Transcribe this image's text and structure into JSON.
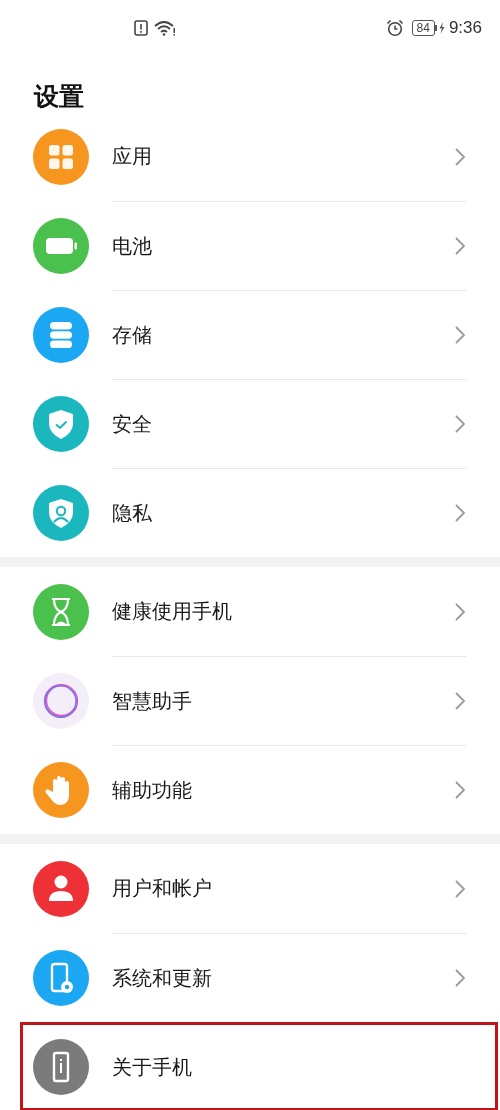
{
  "status_bar": {
    "battery": "84",
    "time": "9:36"
  },
  "title": "设置",
  "groups": [
    {
      "items": [
        {
          "label": "应用",
          "kind": "grid",
          "color": "#f7961e",
          "chevron": true,
          "highlighted": false
        },
        {
          "label": "电池",
          "kind": "battery",
          "color": "#4ac14c",
          "chevron": true,
          "highlighted": false
        },
        {
          "label": "存储",
          "kind": "storage",
          "color": "#1ba7f1",
          "chevron": true,
          "highlighted": false
        },
        {
          "label": "安全",
          "kind": "shield-check",
          "color": "#1bb7bf",
          "chevron": true,
          "highlighted": false
        },
        {
          "label": "隐私",
          "kind": "shield-user",
          "color": "#1bb7bf",
          "chevron": true,
          "highlighted": false
        }
      ]
    },
    {
      "items": [
        {
          "label": "健康使用手机",
          "kind": "hourglass",
          "color": "#4ac14c",
          "chevron": true,
          "highlighted": false
        },
        {
          "label": "智慧助手",
          "kind": "ring",
          "color": "#f3eef8",
          "chevron": true,
          "highlighted": false
        },
        {
          "label": "辅助功能",
          "kind": "hand",
          "color": "#f7961e",
          "chevron": true,
          "highlighted": false
        }
      ]
    },
    {
      "items": [
        {
          "label": "用户和帐户",
          "kind": "user",
          "color": "#ee3037",
          "chevron": true,
          "highlighted": false
        },
        {
          "label": "系统和更新",
          "kind": "phone-gear",
          "color": "#1ba7f1",
          "chevron": true,
          "highlighted": false
        },
        {
          "label": "关于手机",
          "kind": "phone-info",
          "color": "#7b7b7b",
          "chevron": false,
          "highlighted": true
        }
      ]
    }
  ]
}
